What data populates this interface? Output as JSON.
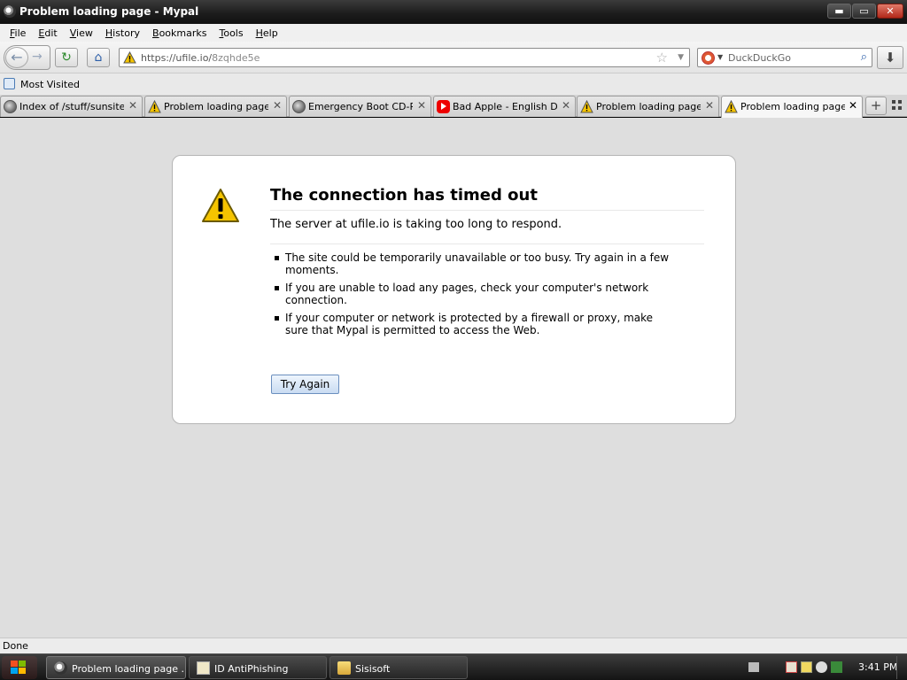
{
  "window": {
    "title": "Problem loading page - Mypal",
    "controls": {
      "minimize": "▬",
      "maximize": "▭",
      "close": "✕"
    }
  },
  "menu": [
    "File",
    "Edit",
    "View",
    "History",
    "Bookmarks",
    "Tools",
    "Help"
  ],
  "menu_underline": [
    "F",
    "E",
    "V",
    "H",
    "B",
    "T",
    "H"
  ],
  "nav": {
    "url_host": "https://ufile.io/",
    "url_path": "8zqhde5e",
    "search_placeholder": "DuckDuckGo"
  },
  "bookmarks": {
    "most_visited": "Most Visited"
  },
  "tabs": [
    {
      "label": "Index of /stuff/sunsite...",
      "icon": "globe-icon"
    },
    {
      "label": "Problem loading page",
      "icon": "warning-icon"
    },
    {
      "label": "Emergency Boot CD-R...",
      "icon": "globe-icon"
    },
    {
      "label": "Bad Apple - English Du...",
      "icon": "youtube-icon"
    },
    {
      "label": "Problem loading page",
      "icon": "warning-icon"
    },
    {
      "label": "Problem loading page",
      "icon": "warning-icon",
      "active": true
    }
  ],
  "error": {
    "title": "The connection has timed out",
    "short": "The server at ufile.io is taking too long to respond.",
    "items": [
      "The site could be temporarily unavailable or too busy. Try again in a few moments.",
      "If you are unable to load any pages, check your computer's network connection.",
      "If your computer or network is protected by a firewall or proxy, make sure that Mypal is permitted to access the Web."
    ],
    "button": "Try Again"
  },
  "status": "Done",
  "taskbar": {
    "tasks": [
      {
        "label": "Problem loading page ...",
        "icon": "mypal-icon"
      },
      {
        "label": "ID AntiPhishing",
        "icon": "app-icon"
      },
      {
        "label": "Sisisoft",
        "icon": "folder-icon"
      }
    ],
    "clock": "3:41 PM"
  },
  "colors": {
    "accent": "#2a5da8",
    "content_bg": "#dedede",
    "warning": "#f5c400"
  }
}
